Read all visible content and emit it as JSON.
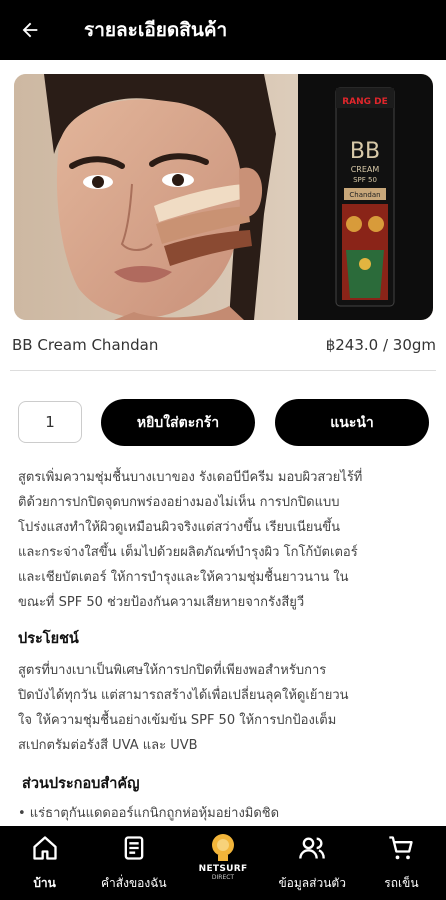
{
  "header": {
    "title": "รายละเอียดสินค้า"
  },
  "product": {
    "name": "BB Cream Chandan",
    "price": "฿243.0 / 30gm",
    "tube_brand": "RANG DE",
    "tube_bb": "BB",
    "tube_cream": "CREAM",
    "tube_spf": "SPF 50",
    "tube_variant": "Chandan"
  },
  "quantity": {
    "value": "1"
  },
  "actions": {
    "add_to_cart": "หยิบใส่ตะกร้า",
    "recommend": "แนะนำ"
  },
  "description": [
    "สูตรเพิ่มความชุ่มชื้นบางเบาของ รังเดอบีบีครีม มอบผิวสวยไร้ที่",
    "ติด้วยการปกปิดจุดบกพร่องอย่างมองไม่เห็น การปกปิดแบบ",
    "โปร่งแสงทำให้ผิวดูเหมือนผิวจริงแต่สว่างขึ้น เรียบเนียนขึ้น",
    "และกระจ่างใสขึ้น เต็มไปด้วยผลิตภัณฑ์บำรุงผิว โกโก้บัตเตอร์",
    "และเชียบัตเตอร์ ให้การบำรุงและให้ความชุ่มชื้นยาวนาน ใน",
    "ขณะที่ SPF 50 ช่วยป้องกันความเสียหายจากรังสียูวี"
  ],
  "benefits": {
    "title": "ประโยชน์",
    "lines": [
      "สูตรที่บางเบาเป็นพิเศษให้การปกปิดที่เพียงพอสำหรับการ",
      "ปิดบังได้ทุกวัน แต่สามารถสร้างได้เพื่อเปลี่ยนลุคให้ดูเย้ายวน",
      "ใจ ให้ความชุ่มชื้นอย่างเข้มข้น SPF 50 ให้การปกป้องเต็ม",
      "สเปกตรัมต่อรังสี UVA และ UVB"
    ]
  },
  "ingredients": {
    "title": "ส่วนประกอบสำคัญ",
    "items": [
      "• แร่ธาตุกันแดดออร์แกนิกถูกห่อหุ้มอย่างมิดชิด"
    ]
  },
  "navbar": {
    "items": [
      {
        "label": "บ้าน",
        "icon": "home-icon"
      },
      {
        "label": "คำสั่งของฉัน",
        "icon": "orders-icon"
      },
      {
        "label": "",
        "icon": "netsurf-logo"
      },
      {
        "label": "ข้อมูลส่วนตัว",
        "icon": "profile-icon"
      },
      {
        "label": "รถเข็น",
        "icon": "cart-icon"
      }
    ],
    "logo_text": "NETSURF",
    "logo_sub": "DIRECT"
  }
}
